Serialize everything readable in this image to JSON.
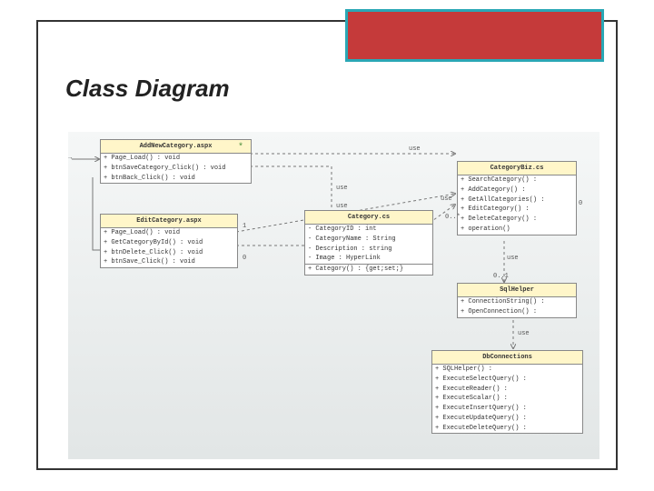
{
  "slide": {
    "title": "Class Diagram"
  },
  "classes": {
    "addNew": {
      "name": "AddNewCategory.aspx",
      "ops": [
        "+ Page_Load() : void",
        "+ btnSaveCategory_Click() : void",
        "+ btnBack_Click() : void"
      ]
    },
    "edit": {
      "name": "EditCategory.aspx",
      "ops": [
        "+ Page_Load() : void",
        "+ GetCategoryById() : void",
        "+ btnDelete_Click() : void",
        "+ btnSave_Click() : void"
      ]
    },
    "category": {
      "name": "Category.cs",
      "attrs": [
        "- CategoryID : int",
        "- CategoryName : String",
        "- Description : string",
        "- Image : HyperLink"
      ],
      "ops": [
        "+ Category() : {get;set;}"
      ]
    },
    "biz": {
      "name": "CategoryBiz.cs",
      "ops": [
        "+ SearchCategory() :",
        "+ AddCategory() :",
        "+ GetAllCategories() :",
        "+ EditCategory() :",
        "+ DeleteCategory() :",
        "+ operation()"
      ]
    },
    "sql": {
      "name": "SqlHelper",
      "ops": [
        "+ ConnectionString() :",
        "+ OpenConnection() :"
      ]
    },
    "db": {
      "name": "DbConnections",
      "ops": [
        "+ SQLHelper() :",
        "+ ExecuteSelectQuery() :",
        "+ ExecuteReader() :",
        "+ ExecuteScalar() :",
        "+ ExecuteInsertQuery() :",
        "+ ExecuteUpdateQuery() :",
        "+ ExecuteDeleteQuery() :"
      ]
    }
  },
  "labels": {
    "use": "use",
    "mult_one": "1",
    "mult_star": "0..*",
    "mult_01": "0..1",
    "mult_0": "0"
  }
}
